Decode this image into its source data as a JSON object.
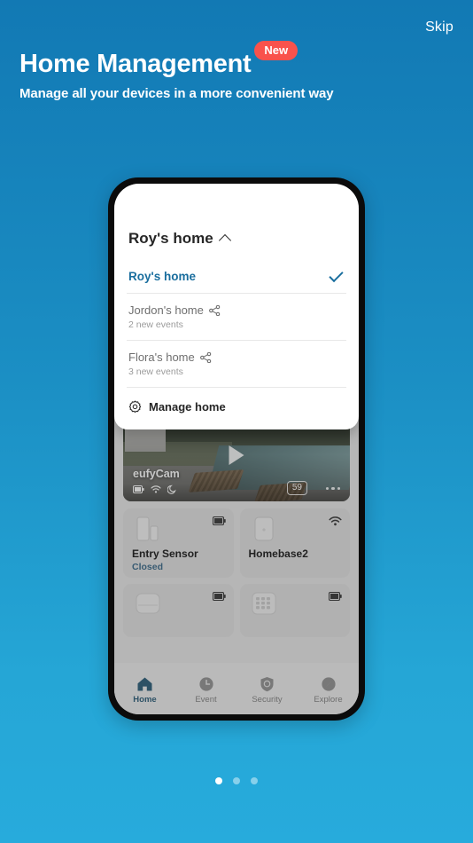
{
  "header": {
    "skip_label": "Skip",
    "title": "Home Management",
    "badge_label": "New",
    "subtitle": "Manage all your devices in a more convenient way",
    "badge_color": "#F9524C"
  },
  "background": {
    "gradient_top": "#1279B4",
    "gradient_bottom": "#27ABDC"
  },
  "phone": {
    "home_panel": {
      "current_home": "Roy's home",
      "collapse_icon": "chevron-up-icon",
      "homes": [
        {
          "name": "Roy's home",
          "subtitle": "",
          "selected": true,
          "shared": false
        },
        {
          "name": "Jordon's home",
          "subtitle": "2 new events",
          "selected": false,
          "shared": true
        },
        {
          "name": "Flora's home",
          "subtitle": "3 new events",
          "selected": false,
          "shared": true
        }
      ],
      "manage_label": "Manage home",
      "manage_icon": "gear-icon",
      "check_icon": "check-icon",
      "share_icon": "share-icon",
      "accent_color": "#1A6E9E"
    },
    "camera_card": {
      "name": "eufyCam",
      "battery_badge": "59",
      "play_icon": "play-icon",
      "status_icons": [
        "battery-icon",
        "wifi-icon",
        "night-mode-icon"
      ],
      "more_icon": "more-options-icon"
    },
    "devices": [
      {
        "name": "Entry Sensor",
        "status": "Closed",
        "corner_icon": "battery-icon",
        "art": "entry-sensor"
      },
      {
        "name": "Homebase2",
        "status": "",
        "corner_icon": "wifi-icon",
        "art": "homebase"
      },
      {
        "name": "",
        "status": "",
        "corner_icon": "battery-icon",
        "art": "motion-sensor"
      },
      {
        "name": "",
        "status": "",
        "corner_icon": "battery-icon",
        "art": "keypad"
      }
    ],
    "nav": [
      {
        "label": "Home",
        "icon": "house-icon",
        "active": true
      },
      {
        "label": "Event",
        "icon": "clock-icon",
        "active": false
      },
      {
        "label": "Security",
        "icon": "shield-icon",
        "active": false
      },
      {
        "label": "Explore",
        "icon": "compass-icon",
        "active": false
      }
    ]
  },
  "pagination": {
    "total": 3,
    "active_index": 0
  }
}
